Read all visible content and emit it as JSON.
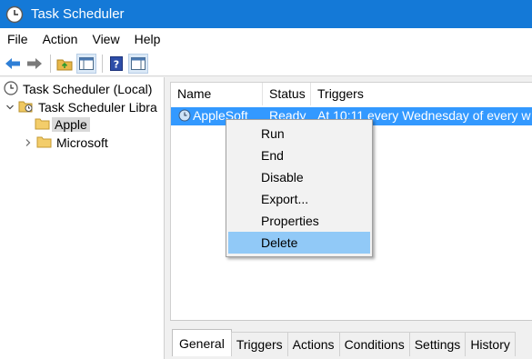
{
  "window": {
    "title": "Task Scheduler"
  },
  "menubar": {
    "items": [
      "File",
      "Action",
      "View",
      "Help"
    ]
  },
  "toolbar": {
    "buttons": [
      "back-icon",
      "forward-icon",
      "up-folder-icon",
      "show-hide-console-tree-icon",
      "help-icon",
      "show-hide-action-pane-icon"
    ]
  },
  "tree": {
    "root": "Task Scheduler (Local)",
    "library": "Task Scheduler Libra",
    "children": [
      "Apple",
      "Microsoft"
    ],
    "selected": "Apple"
  },
  "list": {
    "columns": [
      "Name",
      "Status",
      "Triggers"
    ],
    "rows": [
      {
        "name": "AppleSoft",
        "status": "Ready",
        "triggers": "At 10:11 every Wednesday of every w"
      }
    ]
  },
  "context_menu": {
    "items": [
      "Run",
      "End",
      "Disable",
      "Export...",
      "Properties",
      "Delete"
    ],
    "highlighted": "Delete"
  },
  "detail_tabs": {
    "items": [
      "General",
      "Triggers",
      "Actions",
      "Conditions",
      "Settings",
      "History"
    ],
    "active": "General"
  },
  "colors": {
    "titlebar": "#1479d7",
    "selection": "#3399ff",
    "menu_highlight": "#91c9f7"
  }
}
